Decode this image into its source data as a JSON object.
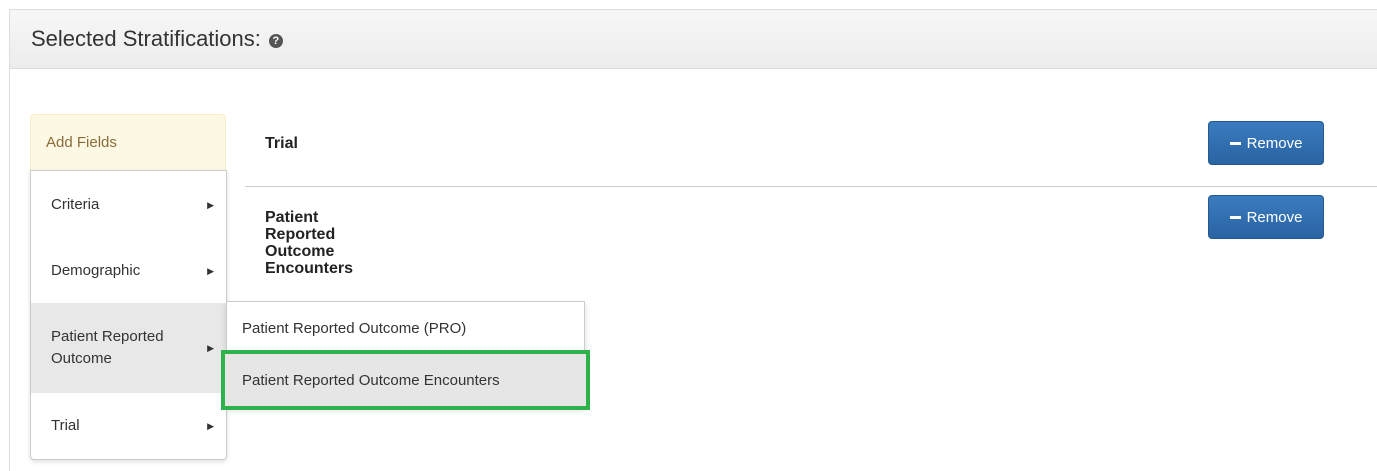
{
  "header": {
    "title": "Selected Stratifications:",
    "help_icon": "?"
  },
  "add_fields": {
    "label": "Add Fields"
  },
  "menu": {
    "items": [
      {
        "label": "Criteria"
      },
      {
        "label": "Demographic"
      },
      {
        "label": "Patient Reported Outcome"
      },
      {
        "label": "Trial"
      }
    ]
  },
  "submenu": {
    "items": [
      {
        "label": "Patient Reported Outcome (PRO)"
      },
      {
        "label": "Patient Reported Outcome Encounters"
      }
    ]
  },
  "stratifications": [
    {
      "title": "Trial",
      "remove_label": "Remove"
    },
    {
      "title": "Patient Reported Outcome Encounters",
      "remove_label": "Remove"
    }
  ],
  "colors": {
    "highlight": "#2eb24a",
    "remove_button": "#2f6faf",
    "add_fields_bg": "#fcf8e3"
  }
}
